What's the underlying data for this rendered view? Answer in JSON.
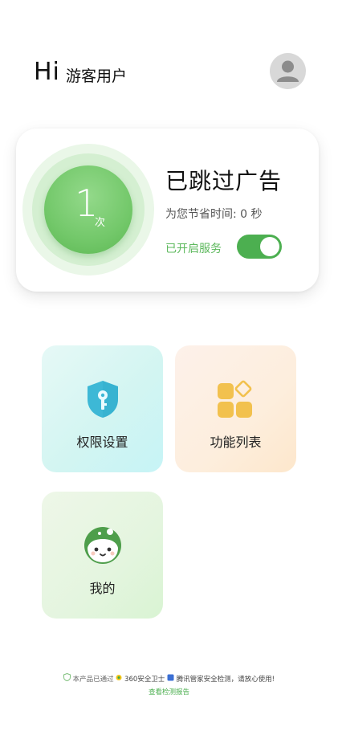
{
  "header": {
    "greeting": "Hi",
    "username": "游客用户"
  },
  "stats": {
    "count": "1",
    "count_unit": "次",
    "title": "已跳过广告",
    "saved_time": "为您节省时间: 0 秒",
    "service_label": "已开启服务",
    "service_on": true
  },
  "tiles": [
    {
      "label": "权限设置",
      "icon": "shield-key-icon"
    },
    {
      "label": "功能列表",
      "icon": "grid-apps-icon"
    },
    {
      "label": "我的",
      "icon": "mascot-icon"
    }
  ],
  "footer": {
    "pre": "本产品已通过",
    "badge1": "360安全卫士",
    "badge2": "腾讯管家安全检测，请放心使用!",
    "report_link": "查看检测报告"
  },
  "colors": {
    "accent_green": "#4caf50",
    "shield_blue": "#3db8d6",
    "grid_yellow": "#f2c14e"
  }
}
